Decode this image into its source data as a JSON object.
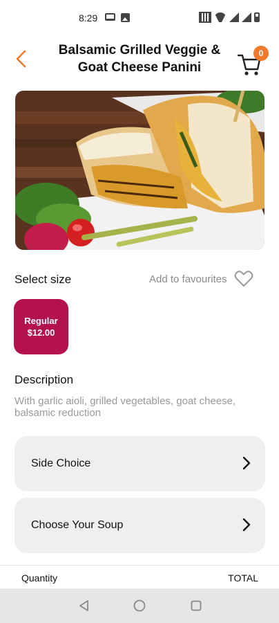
{
  "status_bar": {
    "time": "8:29",
    "icons": [
      "laptop-icon",
      "image-icon",
      "qr-code-icon",
      "wifi-icon",
      "signal-icon",
      "battery-icon"
    ]
  },
  "header": {
    "title": "Balsamic Grilled Veggie & Goat Cheese Panini",
    "back_icon": "chevron-left-icon",
    "cart_icon": "shopping-cart-icon",
    "cart_count": "0"
  },
  "colors": {
    "accent_orange": "#f07a2a",
    "size_card": "#b3124e",
    "option_bg": "#efefef",
    "muted_text": "#9a9a9a"
  },
  "size_section": {
    "label": "Select size",
    "favourite_label": "Add to favourites",
    "favourite_icon": "heart-icon",
    "options": [
      {
        "name": "Regular",
        "price": "$12.00",
        "selected": true
      }
    ]
  },
  "description": {
    "label": "Description",
    "text": "With garlic aioli, grilled vegetables, goat cheese, balsamic reduction"
  },
  "options": [
    {
      "label": "Side Choice"
    },
    {
      "label": "Choose Your Soup"
    }
  ],
  "footer": {
    "quantity_label": "Quantity",
    "total_label": "TOTAL"
  },
  "nav": {
    "icons": [
      "back-triangle-icon",
      "home-circle-icon",
      "recents-square-icon"
    ]
  }
}
